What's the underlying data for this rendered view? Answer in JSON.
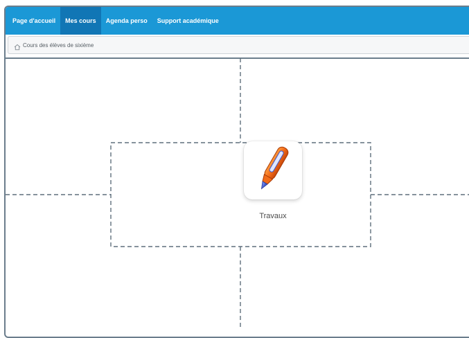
{
  "nav": {
    "items": [
      {
        "label": "Page d'accueil",
        "active": false
      },
      {
        "label": "Mes cours",
        "active": true
      },
      {
        "label": "Agenda perso",
        "active": false
      },
      {
        "label": "Support académique",
        "active": false
      }
    ]
  },
  "breadcrumb": {
    "icon": "home-icon",
    "text": "Cours des élèves de sixième"
  },
  "tile": {
    "icon": "pen-icon",
    "label": "Travaux"
  },
  "colors": {
    "nav_bg": "#1b98d6",
    "nav_active_bg": "#1176b5",
    "border": "#6b7d8c",
    "dashed": "#5f6f7c",
    "pen_orange": "#f26c1a",
    "pen_blue": "#3d57c9"
  }
}
